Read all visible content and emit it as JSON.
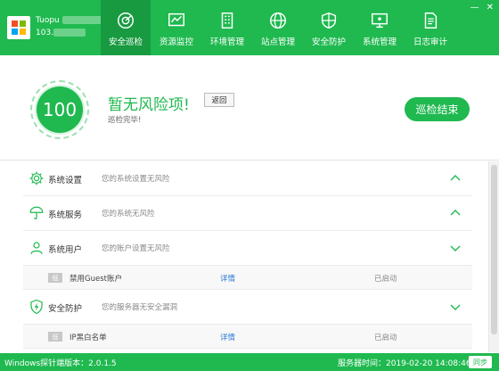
{
  "app": {
    "name": "Tuopu",
    "ip": "103."
  },
  "nav": [
    {
      "label": "安全巡检",
      "icon": "scan-icon"
    },
    {
      "label": "资源监控",
      "icon": "monitor-icon"
    },
    {
      "label": "环境管理",
      "icon": "building-icon"
    },
    {
      "label": "站点管理",
      "icon": "globe-icon"
    },
    {
      "label": "安全防护",
      "icon": "shield-icon"
    },
    {
      "label": "系统管理",
      "icon": "computer-icon"
    },
    {
      "label": "日志审计",
      "icon": "document-icon"
    }
  ],
  "score": {
    "value": "100",
    "title": "暂无风险项!",
    "back_label": "返回",
    "subtitle": "巡检完毕!",
    "finish_label": "巡检结束"
  },
  "categories": [
    {
      "name": "系统设置",
      "desc": "您的系统设置无风险",
      "icon": "gear-icon",
      "expanded": false
    },
    {
      "name": "系统服务",
      "desc": "您的系统无风险",
      "icon": "umbrella-icon",
      "expanded": false
    },
    {
      "name": "系统用户",
      "desc": "您的账户设置无风险",
      "icon": "user-icon",
      "expanded": true
    },
    {
      "name": "安全防护",
      "desc": "您的服务器无安全漏洞",
      "icon": "shield-bolt-icon",
      "expanded": true
    }
  ],
  "subitems": [
    {
      "tag": "低",
      "name": "禁用Guest账户",
      "detail": "详情",
      "state": "已启动"
    },
    {
      "tag": "低",
      "name": "IP黑白名单",
      "detail": "详情",
      "state": "已启动"
    }
  ],
  "footer": {
    "version": "Windows探针端版本：2.0.1.5",
    "server_time": "服务器时间：2019-02-20 14:08:46",
    "sync_label": "同步"
  },
  "colors": {
    "accent": "#1fb94f",
    "accent_dark": "#189a40",
    "link": "#2b7bd8"
  }
}
